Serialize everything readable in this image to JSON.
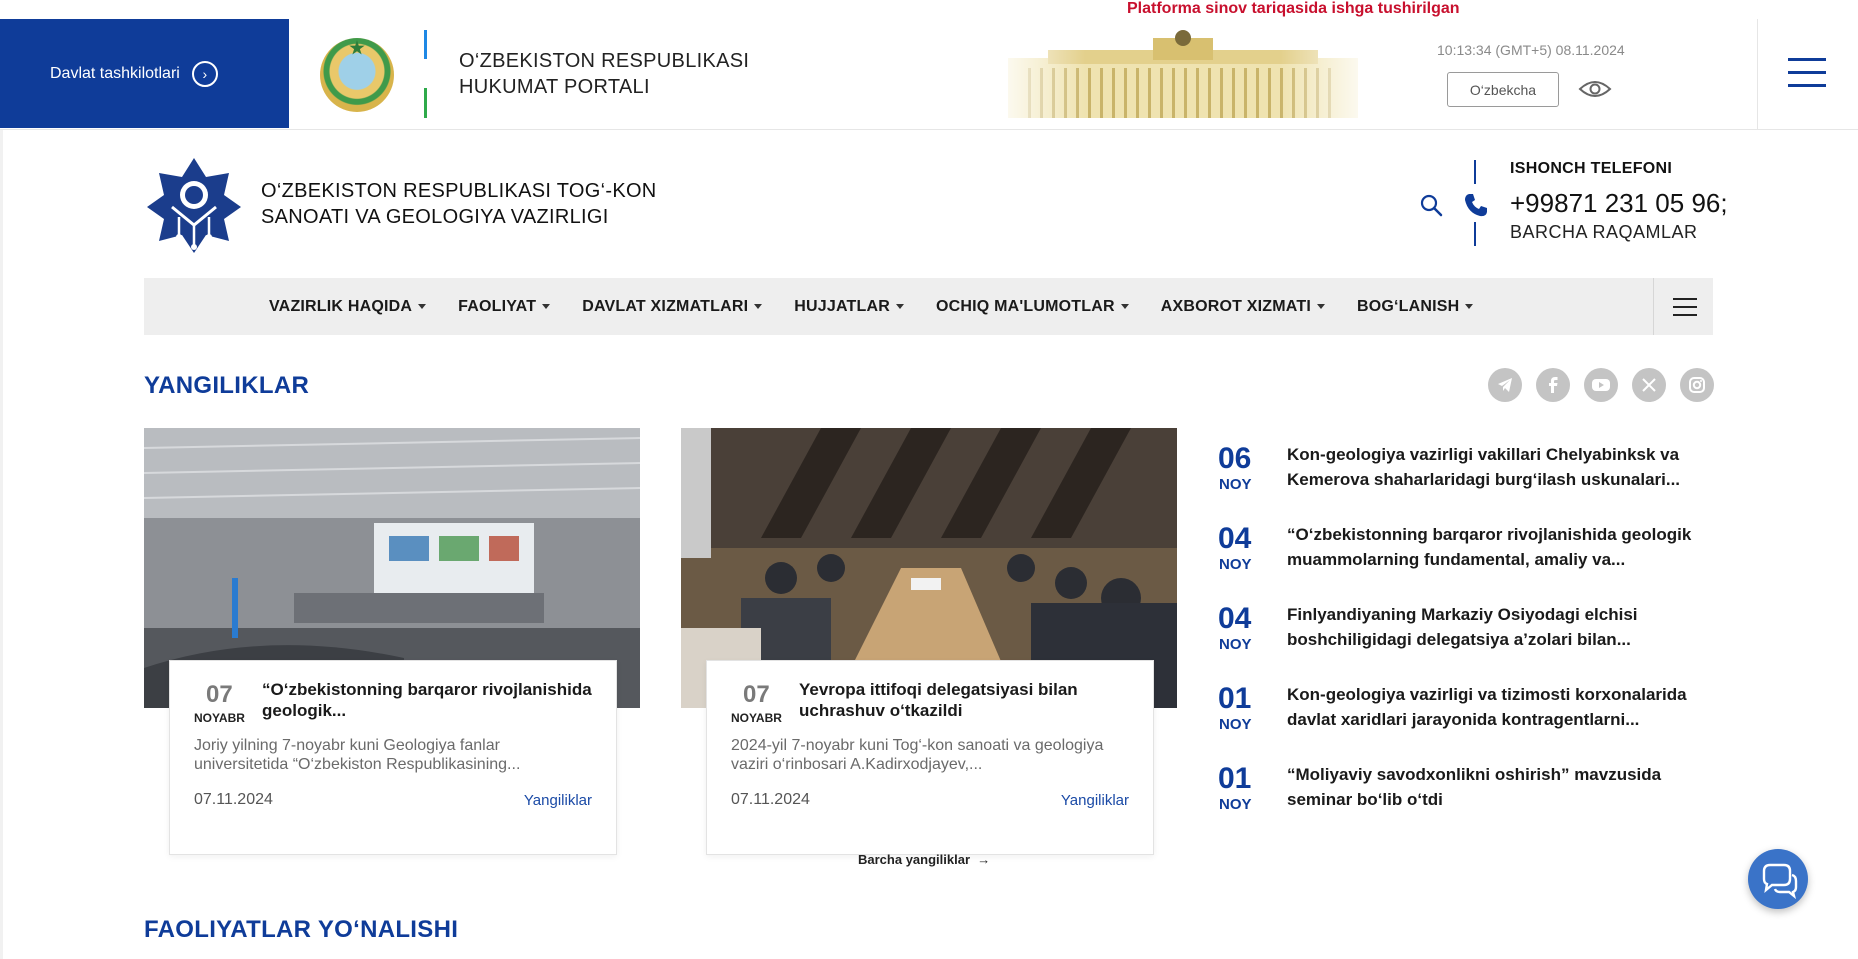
{
  "gov_bar": {
    "orgs_label": "Davlat tashkilotlari",
    "title_line1": "O‘ZBEKISTON RESPUBLIKASI",
    "title_line2": "HUKUMAT PORTALI",
    "notice": "Platforma sinov tariqasida ishga tushirilgan",
    "clock": "10:13:34 (GMT+5) 08.11.2024",
    "language": "O‘zbekcha"
  },
  "ministry": {
    "title_line1": "O‘ZBEKISTON RESPUBLIKASI TOG‘-KON",
    "title_line2": "SANOATI VA GEOLOGIYA VAZIRLIGI",
    "hotline_label": "ISHONCH TELEFONI",
    "hotline_number": "+99871 231 05 96;",
    "hotline_all": "BARCHA RAQAMLAR"
  },
  "nav": {
    "items": [
      {
        "label": "VAZIRLIK HAQIDA"
      },
      {
        "label": "FAOLIYAT"
      },
      {
        "label": "DAVLAT XIZMATLARI"
      },
      {
        "label": "HUJJATLAR"
      },
      {
        "label": "OCHIQ MA'LUMOTLAR"
      },
      {
        "label": "AXBOROT XIZMATI"
      },
      {
        "label": "BOG‘LANISH"
      }
    ]
  },
  "news": {
    "title": "YANGILIKLAR",
    "socials": [
      "telegram-icon",
      "facebook-icon",
      "youtube-icon",
      "x-icon",
      "instagram-icon"
    ],
    "cards": [
      {
        "day": "07",
        "month": "NOYABR",
        "title": "“O‘zbekistonning barqaror rivojlanishida geologik...",
        "desc": "Joriy yilning 7-noyabr kuni Geologiya fanlar universitetida “O‘zbekiston Respublikasining...",
        "date": "07.11.2024",
        "category": "Yangiliklar"
      },
      {
        "day": "07",
        "month": "NOYABR",
        "title": "Yevropa ittifoqi delegatsiyasi bilan uchrashuv o‘tkazildi",
        "desc": "2024-yil 7-noyabr kuni Tog‘-kon sanoati va geologiya vaziri o‘rinbosari A.Kadirxodjayev,...",
        "date": "07.11.2024",
        "category": "Yangiliklar"
      }
    ],
    "side": [
      {
        "day": "06",
        "month": "NOY",
        "title": "Kon-geologiya vazirligi vakillari Chelyabinksk va Kemerova shaharlaridagi burg‘ilash uskunalari..."
      },
      {
        "day": "04",
        "month": "NOY",
        "title": "“O‘zbekistonning barqaror rivojlanishida geologik muammolarning fundamental, amaliy va..."
      },
      {
        "day": "04",
        "month": "NOY",
        "title": "Finlyandiyaning Markaziy Osiyodagi elchisi boshchiligidagi delegatsiya a’zolari bilan..."
      },
      {
        "day": "01",
        "month": "NOY",
        "title": "Kon-geologiya vazirligi va tizimosti korxonalarida davlat xaridlari jarayonida kontragentlarni..."
      },
      {
        "day": "01",
        "month": "NOY",
        "title": "“Moliyaviy savodxonlikni oshirish” mavzusida seminar bo‘lib o‘tdi"
      }
    ],
    "all_label": "Barcha yangiliklar"
  },
  "activities": {
    "title": "FAOLIYATLAR YO‘NALISHI"
  },
  "colors": {
    "brand_blue": "#0f3c99",
    "notice_red": "#c8102e",
    "nav_bg": "#eeeeee"
  }
}
